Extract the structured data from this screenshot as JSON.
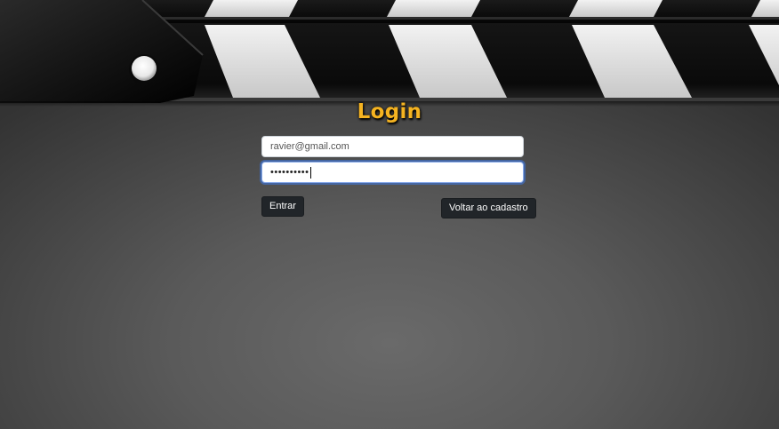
{
  "login": {
    "title": "Login",
    "email_value": "ravier@gmail.com",
    "password_masked": "••••••••••",
    "submit_label": "Entrar",
    "back_label": "Voltar ao cadastro"
  },
  "colors": {
    "title": "#f5b321",
    "button_bg": "#212529",
    "button_text": "#ffffff",
    "focus_ring": "#3c78e6"
  },
  "decoration": {
    "header_image": "film-clapperboard"
  }
}
